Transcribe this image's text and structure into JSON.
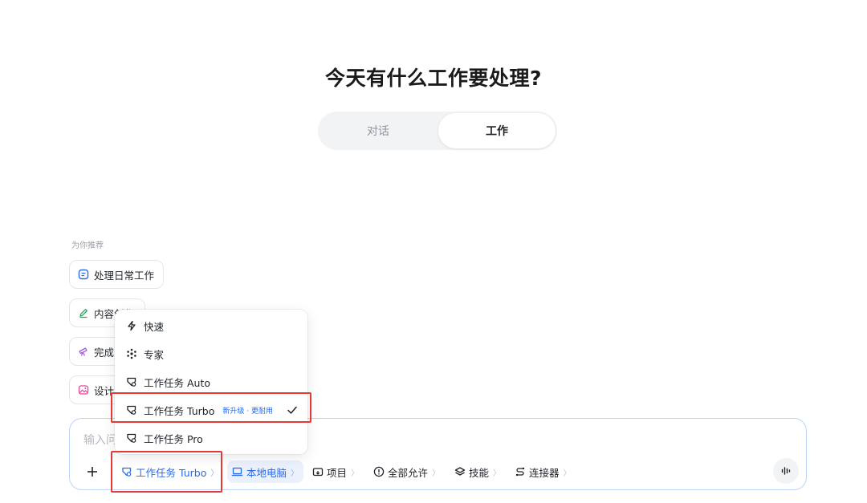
{
  "header": {
    "title": "今天有什么工作要处理?"
  },
  "mode_toggle": {
    "inactive_label": "对话",
    "active_label": "工作"
  },
  "recommendations": {
    "label": "为你推荐",
    "items": [
      {
        "label": "处理日常工作",
        "icon": "document-icon",
        "color": "#2a6ae8"
      },
      {
        "label": "内容创作",
        "icon": "pen-icon",
        "color": "#21a95a"
      },
      {
        "label": "完成",
        "icon": "telescope-icon",
        "color": "#a55be0"
      },
      {
        "label": "设计",
        "icon": "image-icon",
        "color": "#e0489a"
      }
    ]
  },
  "input": {
    "placeholder": "输入问",
    "toolbar": {
      "mode": "工作任务 Turbo",
      "computer": "本地电脑",
      "project": "项目",
      "permission": "全部允许",
      "skills": "技能",
      "connectors": "连接器"
    }
  },
  "mode_menu": {
    "items": [
      {
        "label": "快速",
        "icon": "lightning-icon"
      },
      {
        "label": "专家",
        "icon": "atom-icon"
      },
      {
        "label": "工作任务 Auto",
        "icon": "agent-icon"
      },
      {
        "label": "工作任务 Turbo",
        "icon": "agent-icon",
        "badge": "新升级 · 更耐用",
        "selected": true
      },
      {
        "label": "工作任务 Pro",
        "icon": "agent-icon"
      }
    ]
  },
  "colors": {
    "accent": "#2a6ae8",
    "highlight": "#e53935"
  }
}
